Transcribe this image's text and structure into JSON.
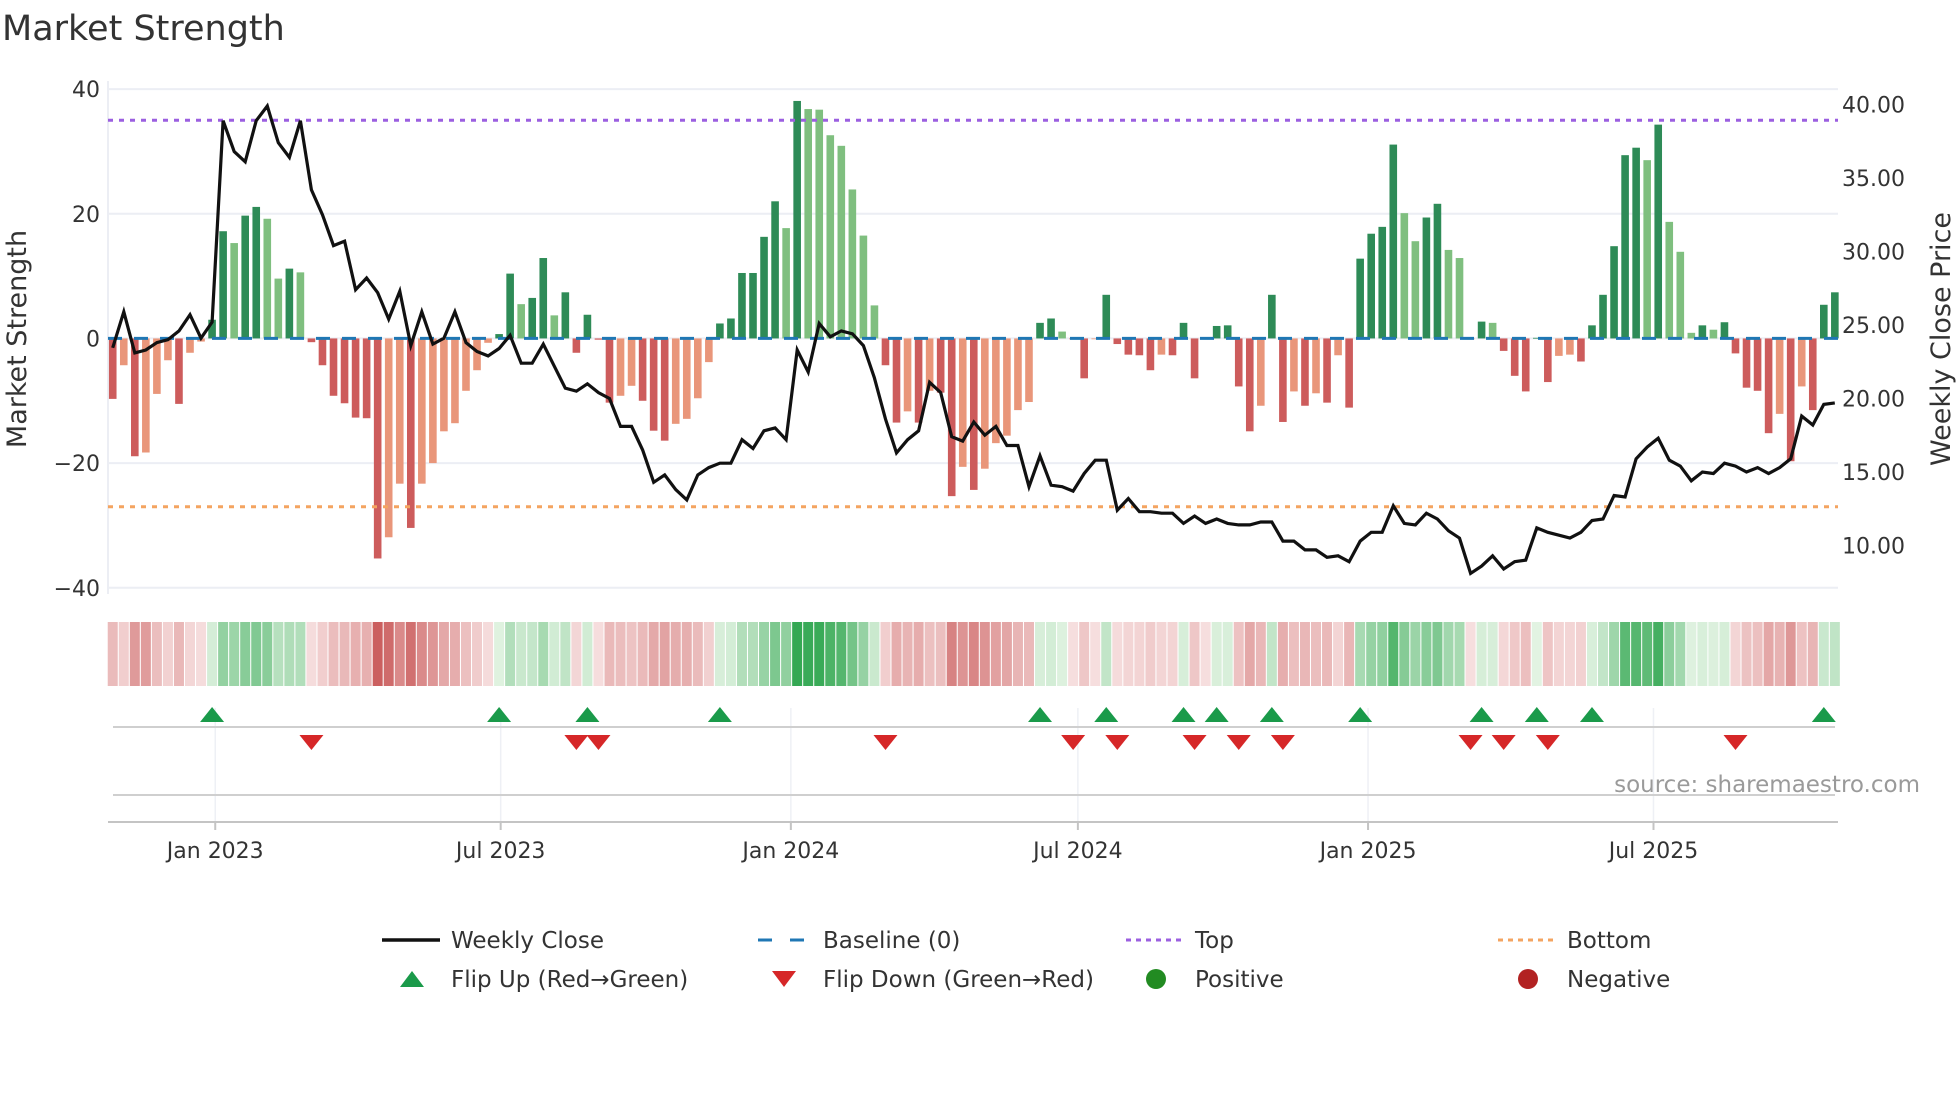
{
  "chart_data": {
    "type": "bar",
    "title": "Market Strength",
    "ylabel": "Market Strength",
    "y2label": "Weekly Close Price",
    "source": "source: sharemaestro.com",
    "xlim": [
      "2022-10-25",
      "2025-10-26"
    ],
    "ylim": [
      -41,
      41.3
    ],
    "y2lim": [
      6.7,
      41.6
    ],
    "grid": true,
    "legend_placement": "bottom",
    "yticks": [
      {
        "value": 40,
        "label": "40"
      },
      {
        "value": 20,
        "label": "20"
      },
      {
        "value": 0,
        "label": "0"
      },
      {
        "value": -20,
        "label": "−20"
      },
      {
        "value": -40,
        "label": "−40"
      }
    ],
    "y2ticks": [
      {
        "value": 40,
        "label": "40.00"
      },
      {
        "value": 35,
        "label": "35.00"
      },
      {
        "value": 30,
        "label": "30.00"
      },
      {
        "value": 25,
        "label": "25.00"
      },
      {
        "value": 20,
        "label": "20.00"
      },
      {
        "value": 15,
        "label": "15.00"
      },
      {
        "value": 10,
        "label": "10.00"
      }
    ],
    "xticks": [
      {
        "date": "2023-01-01",
        "label": "Jan 2023"
      },
      {
        "date": "2023-07-01",
        "label": "Jul 2023"
      },
      {
        "date": "2024-01-01",
        "label": "Jan 2024"
      },
      {
        "date": "2024-07-01",
        "label": "Jul 2024"
      },
      {
        "date": "2025-01-01",
        "label": "Jan 2025"
      },
      {
        "date": "2025-07-01",
        "label": "Jul 2025"
      }
    ],
    "top_level": 35,
    "bottom_level": -27,
    "baseline": 0,
    "colors": {
      "pos_rising": "#2e8b57",
      "pos_falling": "#7fbf7f",
      "neg_falling": "#cd5c5c",
      "neg_rising": "#e9967a",
      "baseline": "#1f77b4",
      "top": "#9b5fe0",
      "bottom": "#f4a460",
      "close": "#111111",
      "flip_up": "#1a9a4a",
      "flip_down": "#d62728",
      "positive": "#228b22",
      "negative": "#b22222"
    },
    "dates": [
      "2022-10-28",
      "2022-11-04",
      "2022-11-11",
      "2022-11-18",
      "2022-11-25",
      "2022-12-02",
      "2022-12-09",
      "2022-12-16",
      "2022-12-23",
      "2022-12-30",
      "2023-01-06",
      "2023-01-13",
      "2023-01-20",
      "2023-01-27",
      "2023-02-03",
      "2023-02-10",
      "2023-02-17",
      "2023-02-24",
      "2023-03-03",
      "2023-03-10",
      "2023-03-17",
      "2023-03-24",
      "2023-03-31",
      "2023-04-07",
      "2023-04-14",
      "2023-04-21",
      "2023-04-28",
      "2023-05-05",
      "2023-05-12",
      "2023-05-19",
      "2023-05-26",
      "2023-06-02",
      "2023-06-09",
      "2023-06-16",
      "2023-06-23",
      "2023-06-30",
      "2023-07-07",
      "2023-07-14",
      "2023-07-21",
      "2023-07-28",
      "2023-08-04",
      "2023-08-11",
      "2023-08-18",
      "2023-08-25",
      "2023-09-01",
      "2023-09-08",
      "2023-09-15",
      "2023-09-22",
      "2023-09-29",
      "2023-10-06",
      "2023-10-13",
      "2023-10-20",
      "2023-10-27",
      "2023-11-03",
      "2023-11-10",
      "2023-11-17",
      "2023-11-24",
      "2023-12-01",
      "2023-12-08",
      "2023-12-15",
      "2023-12-22",
      "2023-12-29",
      "2024-01-05",
      "2024-01-12",
      "2024-01-19",
      "2024-01-26",
      "2024-02-02",
      "2024-02-09",
      "2024-02-16",
      "2024-02-23",
      "2024-03-01",
      "2024-03-08",
      "2024-03-15",
      "2024-03-22",
      "2024-03-29",
      "2024-04-05",
      "2024-04-12",
      "2024-04-19",
      "2024-04-26",
      "2024-05-03",
      "2024-05-10",
      "2024-05-17",
      "2024-05-24",
      "2024-05-31",
      "2024-06-07",
      "2024-06-14",
      "2024-06-21",
      "2024-06-28",
      "2024-07-05",
      "2024-07-12",
      "2024-07-19",
      "2024-07-26",
      "2024-08-02",
      "2024-08-09",
      "2024-08-16",
      "2024-08-23",
      "2024-08-30",
      "2024-09-06",
      "2024-09-13",
      "2024-09-20",
      "2024-09-27",
      "2024-10-04",
      "2024-10-11",
      "2024-10-18",
      "2024-10-25",
      "2024-11-01",
      "2024-11-08",
      "2024-11-15",
      "2024-11-22",
      "2024-11-29",
      "2024-12-06",
      "2024-12-13",
      "2024-12-20",
      "2024-12-27",
      "2025-01-03",
      "2025-01-10",
      "2025-01-17",
      "2025-01-24",
      "2025-01-31",
      "2025-02-07",
      "2025-02-14",
      "2025-02-21",
      "2025-02-28",
      "2025-03-07",
      "2025-03-14",
      "2025-03-21",
      "2025-03-28",
      "2025-04-04",
      "2025-04-11",
      "2025-04-18",
      "2025-04-25",
      "2025-05-02",
      "2025-05-09",
      "2025-05-16",
      "2025-05-23",
      "2025-05-30",
      "2025-06-06",
      "2025-06-13",
      "2025-06-20",
      "2025-06-27",
      "2025-07-04",
      "2025-07-11",
      "2025-07-18",
      "2025-07-25",
      "2025-08-01",
      "2025-08-08",
      "2025-08-15",
      "2025-08-22",
      "2025-08-29",
      "2025-09-05",
      "2025-09-12",
      "2025-09-19",
      "2025-09-26",
      "2025-10-03",
      "2025-10-10",
      "2025-10-17",
      "2025-10-24"
    ],
    "strength": [
      -9.7,
      -4.3,
      -18.9,
      -18.3,
      -8.9,
      -3.5,
      -10.5,
      -2.3,
      -0.5,
      3.0,
      17.2,
      15.3,
      19.7,
      21.1,
      19.2,
      9.6,
      11.2,
      10.6,
      -0.6,
      -4.3,
      -9.2,
      -10.4,
      -12.7,
      -12.8,
      -35.3,
      -31.9,
      -23.3,
      -30.4,
      -23.3,
      -20.0,
      -14.9,
      -13.6,
      -8.4,
      -5.1,
      -0.7,
      0.7,
      10.4,
      5.5,
      6.5,
      12.9,
      3.7,
      7.4,
      -2.3,
      3.8,
      -0.2,
      -10.3,
      -9.2,
      -7.6,
      -10.0,
      -14.8,
      -16.4,
      -13.7,
      -12.9,
      -9.6,
      -3.8,
      2.4,
      3.2,
      10.5,
      10.5,
      16.3,
      22.0,
      17.7,
      38.1,
      36.8,
      36.7,
      32.6,
      30.9,
      23.9,
      16.5,
      5.3,
      -4.3,
      -13.5,
      -11.7,
      -13.5,
      -8.4,
      -8.7,
      -25.3,
      -20.6,
      -24.3,
      -20.9,
      -16.8,
      -15.6,
      -11.5,
      -10.2,
      2.5,
      3.2,
      1.1,
      -0.1,
      -6.4,
      -0.1,
      7.0,
      -0.9,
      -2.6,
      -2.7,
      -5.1,
      -2.6,
      -2.7,
      2.5,
      -6.4,
      -0.1,
      2.0,
      2.1,
      -7.7,
      -14.9,
      -10.8,
      7.0,
      -13.4,
      -8.5,
      -10.8,
      -8.8,
      -10.3,
      -2.7,
      -11.1,
      12.8,
      16.8,
      17.9,
      31.1,
      20.1,
      15.6,
      19.4,
      21.6,
      14.2,
      12.9,
      -0.1,
      2.7,
      2.5,
      -2.0,
      -6.0,
      -8.5,
      0.1,
      -7.0,
      -2.8,
      -2.6,
      -3.7,
      2.1,
      7.0,
      14.8,
      29.4,
      30.6,
      28.6,
      34.3,
      18.7,
      13.9,
      0.9,
      2.1,
      1.4,
      2.6,
      -2.4,
      -7.9,
      -8.4,
      -15.2,
      -12.1,
      -19.7,
      -7.7,
      -11.5,
      5.4,
      7.4
    ],
    "weekly_close": [
      23.45,
      25.9,
      23.1,
      23.3,
      23.8,
      24.0,
      24.6,
      25.7,
      24.1,
      25.2,
      38.9,
      36.8,
      36.1,
      38.9,
      39.9,
      37.4,
      36.4,
      38.9,
      34.2,
      32.5,
      30.4,
      30.7,
      27.4,
      28.2,
      27.2,
      25.4,
      27.3,
      23.6,
      25.9,
      23.7,
      24.1,
      25.9,
      23.8,
      23.2,
      22.9,
      23.4,
      24.3,
      22.4,
      22.4,
      23.7,
      22.2,
      20.7,
      20.5,
      21.0,
      20.4,
      20.0,
      18.1,
      18.1,
      16.5,
      14.3,
      14.8,
      13.8,
      13.1,
      14.8,
      15.3,
      15.6,
      15.6,
      17.2,
      16.6,
      17.8,
      18.0,
      17.2,
      23.3,
      21.8,
      25.1,
      24.2,
      24.6,
      24.4,
      23.6,
      21.4,
      18.6,
      16.3,
      17.2,
      17.8,
      21.1,
      20.4,
      17.4,
      17.1,
      18.4,
      17.5,
      18.1,
      16.8,
      16.8,
      14.0,
      16.1,
      14.1,
      14.0,
      13.7,
      14.9,
      15.8,
      15.8,
      12.4,
      13.2,
      12.3,
      12.3,
      12.2,
      12.2,
      11.5,
      12.0,
      11.5,
      11.8,
      11.5,
      11.4,
      11.4,
      11.6,
      11.6,
      10.3,
      10.3,
      9.7,
      9.7,
      9.2,
      9.3,
      8.9,
      10.3,
      10.9,
      10.9,
      12.7,
      11.5,
      11.4,
      12.2,
      11.8,
      11.0,
      10.5,
      8.1,
      8.6,
      9.3,
      8.4,
      8.9,
      9.0,
      11.2,
      10.9,
      10.7,
      10.5,
      10.9,
      11.7,
      11.8,
      13.4,
      13.3,
      15.9,
      16.7,
      17.3,
      15.8,
      15.4,
      14.4,
      15.0,
      14.9,
      15.6,
      15.4,
      15.0,
      15.3,
      14.9,
      15.3,
      15.9,
      18.8,
      18.2,
      19.6,
      19.7
    ],
    "legend": [
      {
        "key": "close",
        "label": "Weekly Close",
        "icon": "solid-line"
      },
      {
        "key": "baseline",
        "label": "Baseline (0)",
        "icon": "dashed-line"
      },
      {
        "key": "top",
        "label": "Top",
        "icon": "dotted-line"
      },
      {
        "key": "bottom",
        "label": "Bottom",
        "icon": "dotted-line"
      },
      {
        "key": "flip_up",
        "label": "Flip Up (Red→Green)",
        "icon": "triangle-up"
      },
      {
        "key": "flip_down",
        "label": "Flip Down (Green→Red)",
        "icon": "triangle-down"
      },
      {
        "key": "positive",
        "label": "Positive",
        "icon": "circle"
      },
      {
        "key": "negative",
        "label": "Negative",
        "icon": "circle"
      }
    ]
  }
}
